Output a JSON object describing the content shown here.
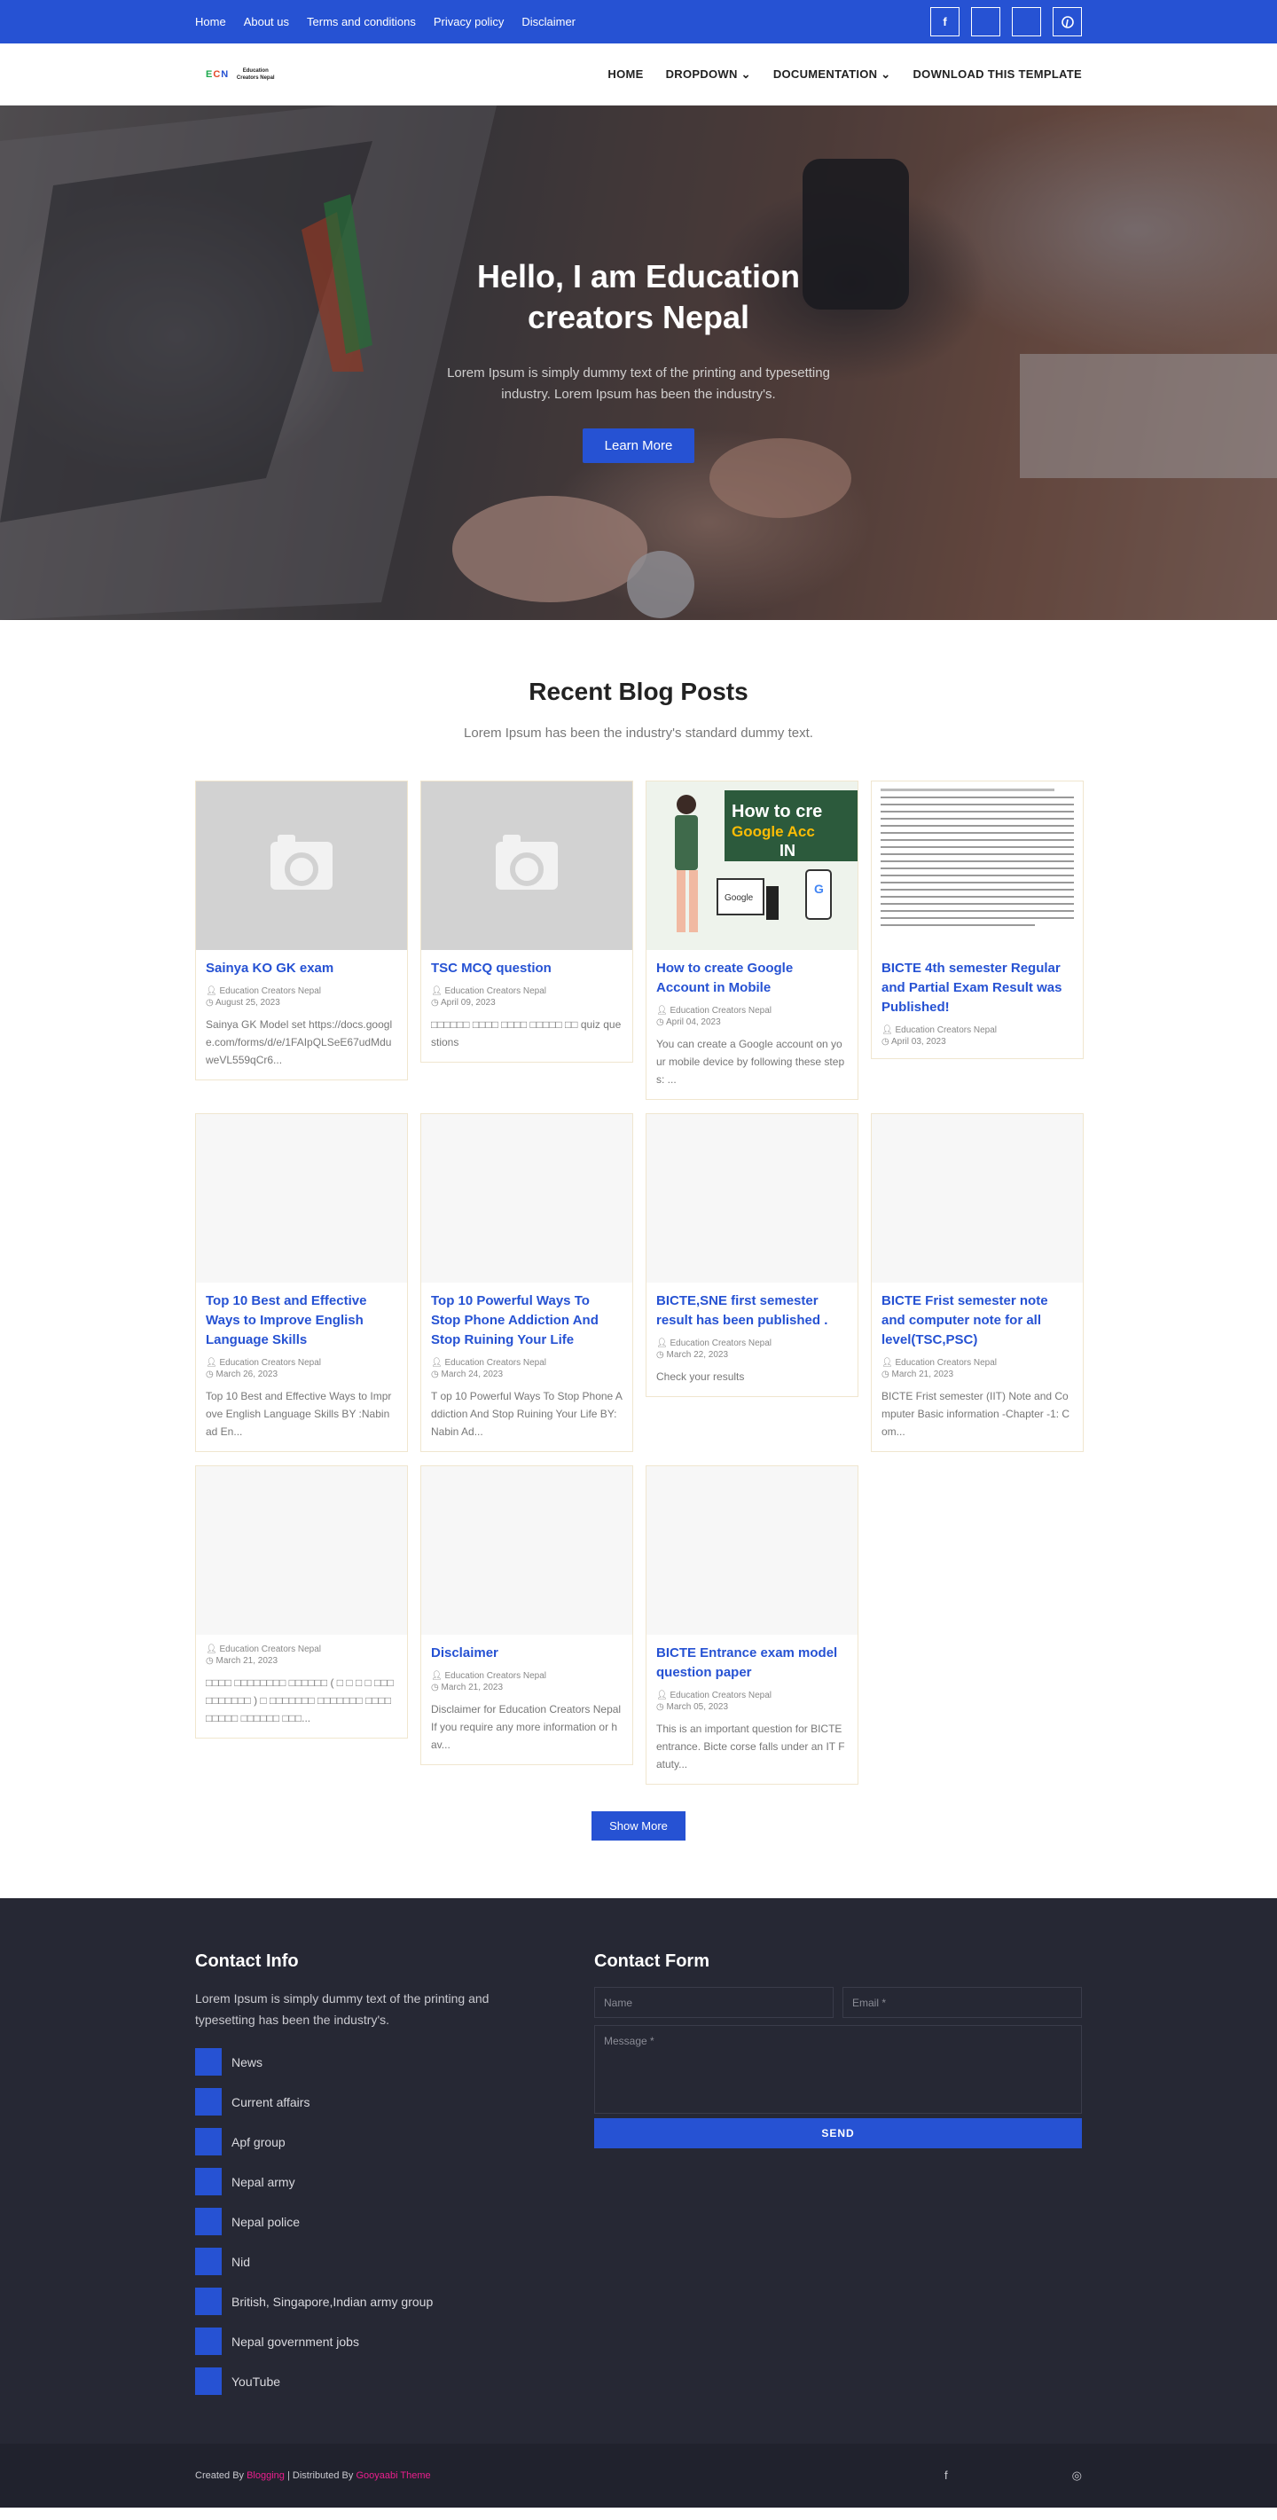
{
  "topbar": {
    "links": [
      "Home",
      "About us",
      "Terms and conditions",
      "Privacy policy",
      "Disclaimer"
    ],
    "social_icons": [
      "facebook-icon",
      "twitter-icon",
      "instagram-icon",
      "pinterest-icon"
    ]
  },
  "header": {
    "logo_mark": "ECN",
    "logo_text": "Education Creators Nepal",
    "nav": [
      "HOME",
      "DROPDOWN",
      "DOCUMENTATION",
      "DOWNLOAD THIS TEMPLATE"
    ]
  },
  "hero": {
    "title": "Hello, I am Education creators Nepal",
    "text": "Lorem Ipsum is simply dummy text of the printing and typesetting industry. Lorem Ipsum has been the industry's.",
    "button": "Learn More"
  },
  "blog": {
    "heading": "Recent Blog Posts",
    "subheading": "Lorem Ipsum has been the industry's standard dummy text.",
    "posts": [
      {
        "title": "Sainya KO GK exam",
        "author": "Education Creators Nepal",
        "date": "August 25, 2023",
        "excerpt": "Sainya GK Model set https://docs.google.com/forms/d/e/1FAIpQLSeE67udMduweVL559qCr6..."
      },
      {
        "title": "TSC MCQ question",
        "author": "Education Creators Nepal",
        "date": "April 09, 2023",
        "excerpt": "□□□□□□ □□□□ □□□□ □□□□□ □□ quiz questions"
      },
      {
        "title": "How to create Google Account in Mobile",
        "author": "Education Creators Nepal",
        "date": "April 04, 2023",
        "excerpt": "You can create a Google account on your mobile device by following these steps: ..."
      },
      {
        "title": "BICTE 4th semester Regular and Partial Exam Result was Published!",
        "author": "Education Creators Nepal",
        "date": "April 03, 2023",
        "excerpt": ""
      },
      {
        "title": "Top 10 Best and Effective Ways to Improve English Language Skills",
        "author": "Education Creators Nepal",
        "date": "March 26, 2023",
        "excerpt": "Top 10 Best and Effective Ways to Improve English Language Skills BY :Nabin ad En..."
      },
      {
        "title": "Top 10 Powerful Ways To Stop Phone Addiction And Stop Ruining Your Life",
        "author": "Education Creators Nepal",
        "date": "March 24, 2023",
        "excerpt": "T op 10 Powerful Ways To Stop Phone Addiction And Stop Ruining Your Life BY: Nabin Ad..."
      },
      {
        "title": "BICTE,SNE first semester result has been published .",
        "author": "Education Creators Nepal",
        "date": "March 22, 2023",
        "excerpt": "Check your results"
      },
      {
        "title": "BICTE Frist semester note and computer note for all level(TSC,PSC)",
        "author": "Education Creators Nepal",
        "date": "March 21, 2023",
        "excerpt": "BICTE Frist semester (IIT) Note and Computer Basic information -Chapter -1: Com..."
      },
      {
        "title": "",
        "author": "Education Creators Nepal",
        "date": "March 21, 2023",
        "excerpt": "□□□□ □□□□□□□□ □□□□□□ ( □ □ □ □ □□□□□□□□□□ ) □ □□□□□□□ □□□□□□□ □□□□ □□□□□ □□□□□□ □□□..."
      },
      {
        "title": "Disclaimer",
        "author": "Education Creators Nepal",
        "date": "March 21, 2023",
        "excerpt": "Disclaimer for Education Creators Nepal If you require any more information or hav..."
      },
      {
        "title": "BICTE Entrance exam model question paper",
        "author": "Education Creators Nepal",
        "date": "March 05, 2023",
        "excerpt": "This is an important question for BICTE entrance. Bicte corse falls under an IT Fatuty..."
      }
    ],
    "show_more": "Show More",
    "illustration_text": "How to cre Google Acc IN"
  },
  "footer": {
    "contact_info_title": "Contact Info",
    "contact_info_text": "Lorem Ipsum is simply dummy text of the printing and typesetting has been the industry's.",
    "links": [
      "News",
      "Current affairs",
      "Apf group",
      "Nepal army",
      "Nepal police",
      "Nid",
      "British, Singapore,Indian army group",
      "Nepal government jobs",
      "YouTube"
    ],
    "form_title": "Contact Form",
    "name_placeholder": "Name",
    "email_placeholder": "Email *",
    "message_placeholder": "Message *",
    "send_label": "SEND"
  },
  "bottom": {
    "created_by": "Created By",
    "blogging": "Blogging",
    "distributed_by": "| Distributed By",
    "theme": "Gooyaabi Theme"
  },
  "colors": {
    "accent": "#2652d3",
    "footer_bg": "#262834",
    "pink": "#e91e8c"
  }
}
